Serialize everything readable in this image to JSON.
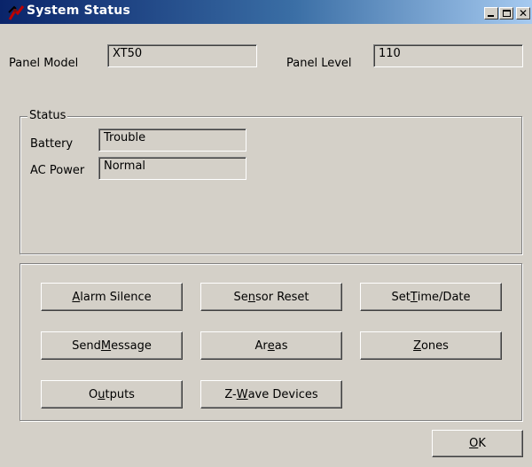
{
  "window": {
    "title": "System Status",
    "icon": "dmp-app-icon",
    "controls": {
      "minimize": "minimize-icon",
      "maximize": "maximize-icon",
      "close": "close-icon"
    }
  },
  "panel": {
    "model_label": "Panel Model",
    "model_value": "XT50",
    "level_label": "Panel Level",
    "level_value": "110"
  },
  "status": {
    "group_label": "Status",
    "battery_label": "Battery",
    "battery_value": "Trouble",
    "ac_power_label": "AC Power",
    "ac_power_value": "Normal"
  },
  "actions": {
    "alarm_silence": {
      "pre": "",
      "key": "A",
      "post": "larm Silence"
    },
    "sensor_reset": {
      "pre": "Se",
      "key": "n",
      "post": "sor Reset"
    },
    "set_time_date": {
      "pre": "Set ",
      "key": "T",
      "post": "ime/Date"
    },
    "send_message": {
      "pre": "Send ",
      "key": "M",
      "post": "essage"
    },
    "areas": {
      "pre": "Ar",
      "key": "e",
      "post": "as"
    },
    "zones": {
      "pre": "",
      "key": "Z",
      "post": "ones"
    },
    "outputs": {
      "pre": "O",
      "key": "u",
      "post": "tputs"
    },
    "zwave_devices": {
      "pre": "Z-",
      "key": "W",
      "post": "ave Devices"
    }
  },
  "ok_button": {
    "pre": "",
    "key": "O",
    "post": "K"
  },
  "colors": {
    "window_bg": "#d4d0c8",
    "titlebar_start": "#0a246a",
    "titlebar_end": "#a6caf0",
    "title_text": "#ffffff"
  }
}
